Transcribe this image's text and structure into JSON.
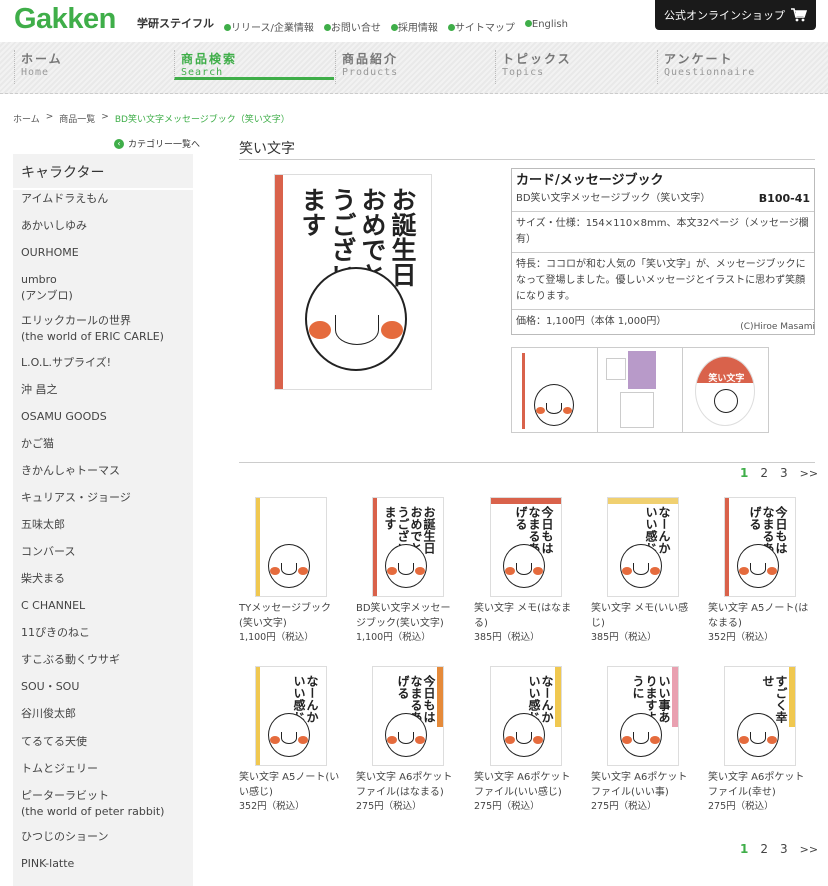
{
  "header": {
    "logo": "Gakken",
    "logo_sub": "学研ステイフル",
    "links": [
      "リリース/企業情報",
      "お問い合せ",
      "採用情報",
      "サイトマップ",
      "English"
    ],
    "shop_button": "公式オンラインショップ"
  },
  "nav": [
    {
      "jp": "ホーム",
      "en": "Home"
    },
    {
      "jp": "商品検索",
      "en": "Search"
    },
    {
      "jp": "商品紹介",
      "en": "Products"
    },
    {
      "jp": "トピックス",
      "en": "Topics"
    },
    {
      "jp": "アンケート",
      "en": "Questionnaire"
    }
  ],
  "breadcrumb": [
    "ホーム",
    "商品一覧",
    "BD笑い文字メッセージブック（笑い文字）"
  ],
  "sidebar": {
    "category_link": "カテゴリー一覧へ",
    "heading": "キャラクター",
    "items": [
      "アイムドラえもん",
      "あかいしゆみ",
      "OURHOME",
      "umbro\n(アンブロ)",
      "エリックカールの世界\n(the world of ERIC CARLE)",
      "L.O.L.サプライズ!",
      "沖 昌之",
      "OSAMU GOODS",
      "かご猫",
      "きかんしゃトーマス",
      "キュリアス・ジョージ",
      "五味太郎",
      "コンバース",
      "柴犬まる",
      "C CHANNEL",
      "11ぴきのねこ",
      "すこぶる動くウサギ",
      "SOU・SOU",
      "谷川俊太郎",
      "てるてる天使",
      "トムとジェリー",
      "ピーターラビット\n(the world of peter rabbit)",
      "ひつじのショーン",
      "PINK-latte"
    ]
  },
  "page_title": "笑い文字",
  "main_image_text": "お誕生日おめでとうございます",
  "info": {
    "category": "カード/メッセージブック",
    "product_name": "BD笑い文字メッセージブック（笑い文字）",
    "code": "B100-41",
    "size": "サイズ・仕様：154×110×8mm、本文32ページ（メッセージ欄有）",
    "feature": "特長：ココロが和む人気の「笑い文字」が、メッセージブックになって登場しました。優しいメッセージとイラストに思わず笑顔になります。",
    "price": "価格：1,100円（本体 1,000円）"
  },
  "credit": "(C)Hiroe Masami",
  "thumb_badge": "笑い文字",
  "pager": {
    "pages": [
      "1",
      "2",
      "3"
    ],
    "next": ">>"
  },
  "products": [
    {
      "name": "TYメッセージブック(笑い文字)",
      "price": "1,100円（税込）",
      "art": "",
      "stripe": "#f0c850"
    },
    {
      "name": "BD笑い文字メッセージブック(笑い文字)",
      "price": "1,100円（税込）",
      "art": "お誕生日おめでとうございます",
      "stripe": "#d9624b"
    },
    {
      "name": "笑い文字 メモ(はなまる)",
      "price": "385円（税込）",
      "art": "今日もはなまるあげる",
      "stripe": "#d9624b"
    },
    {
      "name": "笑い文字 メモ(いい感じ)",
      "price": "385円（税込）",
      "art": "なーんかいい感じ",
      "stripe": "#f0d070"
    },
    {
      "name": "笑い文字 A5ノート(はなまる)",
      "price": "352円（税込）",
      "art": "今日もはなまるあげる",
      "stripe": "#d9624b"
    },
    {
      "name": "笑い文字 A5ノート(いい感じ)",
      "price": "352円（税込）",
      "art": "なーんかいい感じ",
      "stripe": "#f0c850"
    },
    {
      "name": "笑い文字 A6ポケットファイル(はなまる)",
      "price": "275円（税込）",
      "art": "今日もはなまるあげる",
      "stripe": "#e58a3a"
    },
    {
      "name": "笑い文字 A6ポケットファイル(いい感じ)",
      "price": "275円（税込）",
      "art": "なーんかいい感じ",
      "stripe": "#f0c850"
    },
    {
      "name": "笑い文字 A6ポケットファイル(いい事)",
      "price": "275円（税込）",
      "art": "いい事ありますように",
      "stripe": "#e9a0b0"
    },
    {
      "name": "笑い文字 A6ポケットファイル(幸せ)",
      "price": "275円（税込）",
      "art": "すごく幸せ",
      "stripe": "#f0c850"
    }
  ],
  "colors": {
    "brand_green": "#3fae49",
    "shop_black": "#1a1a1a",
    "sidebar_bg": "#f2f2f2"
  }
}
